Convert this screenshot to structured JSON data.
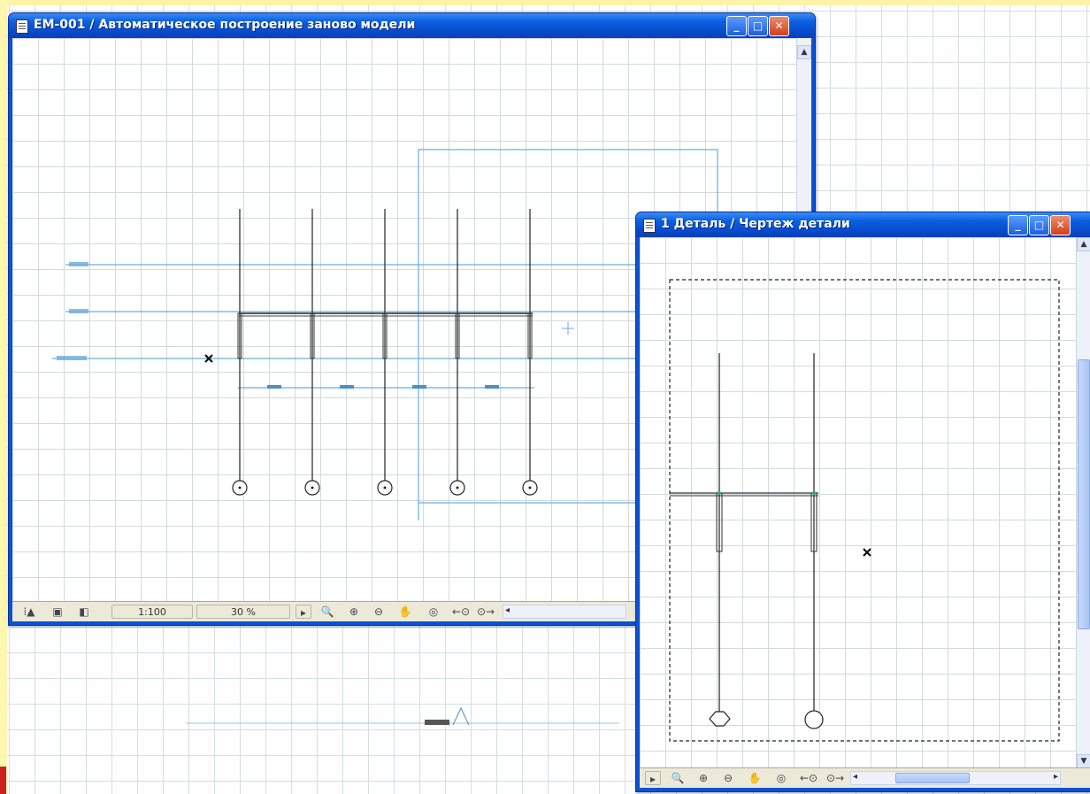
{
  "windows": {
    "main": {
      "title": "EM-001  / Автоматическое построение заново модели",
      "controls": {
        "minimize": "_",
        "maximize": "□",
        "close": "✕"
      },
      "status": {
        "scale": "1:100",
        "zoom": "30 %"
      },
      "icons": [
        "mark-icon",
        "preview-icon",
        "layer-icon",
        "arrow-right-icon",
        "zoom-in-out-icon",
        "zoom-in-icon",
        "zoom-out-icon",
        "pan-hand-icon",
        "fit-in-window-icon",
        "previous-zoom-icon",
        "next-zoom-icon",
        "scroll-left-icon"
      ]
    },
    "detail": {
      "title": "1 Деталь / Чертеж детали",
      "controls": {
        "minimize": "_",
        "maximize": "□",
        "close": "✕"
      },
      "icons": [
        "arrow-right-icon",
        "zoom-in-out-icon",
        "zoom-in-icon",
        "zoom-out-icon",
        "pan-hand-icon",
        "fit-in-window-icon",
        "previous-zoom-icon",
        "next-zoom-icon",
        "scroll-left-icon",
        "scroll-right-icon"
      ]
    }
  },
  "colors": {
    "title_bar": "#0a5ee0",
    "accent_line": "#6aaee0",
    "band": "#fff3a8"
  }
}
